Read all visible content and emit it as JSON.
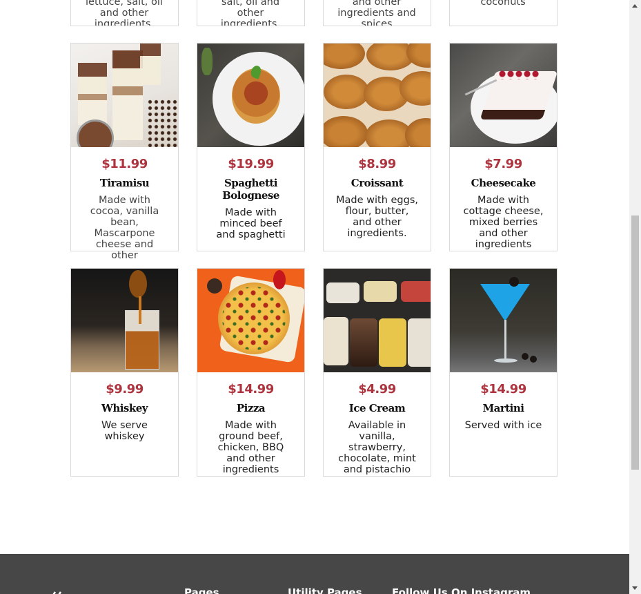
{
  "top_row": [
    {
      "desc": "avocado, eggs, lettuce, salt, oil and other ingredients."
    },
    {
      "desc": "salt, oil and other ingredients."
    },
    {
      "desc": "and other ingredients and spices"
    },
    {
      "desc": "coconuts"
    }
  ],
  "menu_items": [
    {
      "price": "$11.99",
      "name": "Tiramisu",
      "desc": "Made with cocoa, vanilla bean, Mascarpone cheese and other ingredients",
      "image": "tiramisu-photo"
    },
    {
      "price": "$19.99",
      "name": "Spaghetti Bolognese",
      "desc": "Made with minced beef and spaghetti",
      "image": "spaghetti-photo"
    },
    {
      "price": "$8.99",
      "name": "Croissant",
      "desc": "Made with eggs, flour, butter, and other ingredients.",
      "image": "croissant-photo"
    },
    {
      "price": "$7.99",
      "name": "Cheesecake",
      "desc": "Made with cottage cheese, mixed berries and other ingredients",
      "image": "cheesecake-photo"
    },
    {
      "price": "$9.99",
      "name": "Whiskey",
      "desc": "We serve whiskey",
      "image": "whiskey-photo"
    },
    {
      "price": "$14.99",
      "name": "Pizza",
      "desc": "Made with ground beef, chicken, BBQ and other ingredients",
      "image": "pizza-photo"
    },
    {
      "price": "$4.99",
      "name": "Ice Cream",
      "desc": "Available in vanilla, strawberry, chocolate, mint and pistachio",
      "image": "ice-cream-photo"
    },
    {
      "price": "$14.99",
      "name": "Martini",
      "desc": "Served with ice",
      "image": "martini-photo"
    }
  ],
  "footer": {
    "col1": "Pages",
    "col2": "Utility Pages",
    "col3": "Follow Us On Instagram"
  },
  "colors": {
    "price": "#ad343e",
    "footer_bg": "#474747"
  }
}
